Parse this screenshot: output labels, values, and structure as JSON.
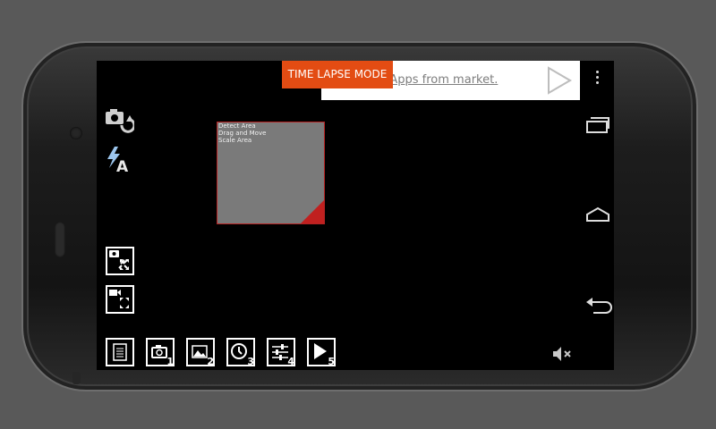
{
  "ad": {
    "text": "Get FREE Apps from market."
  },
  "mode": {
    "label": "TIME LAPSE MODE"
  },
  "detect_area": {
    "lines": [
      "Detect Area",
      "Drag and Move",
      "Scale Area"
    ]
  },
  "left_icons": [
    "camera-switch-icon",
    "flash-auto-icon",
    "photo-fullscreen-icon",
    "video-fullscreen-icon"
  ],
  "bottom_toolbar": [
    {
      "icon": "list-icon",
      "number": ""
    },
    {
      "icon": "camera-icon",
      "number": "1"
    },
    {
      "icon": "gallery-icon",
      "number": "2"
    },
    {
      "icon": "clock-icon",
      "number": "3"
    },
    {
      "icon": "settings-sliders-icon",
      "number": "4"
    },
    {
      "icon": "play-icon",
      "number": "5"
    }
  ],
  "nav": [
    "overflow-menu-icon",
    "recent-apps-icon",
    "home-icon",
    "back-icon"
  ],
  "colors": {
    "mode_bg": "#e34c13",
    "detect_border": "#b42222",
    "detect_bg": "#7a7a7a"
  }
}
